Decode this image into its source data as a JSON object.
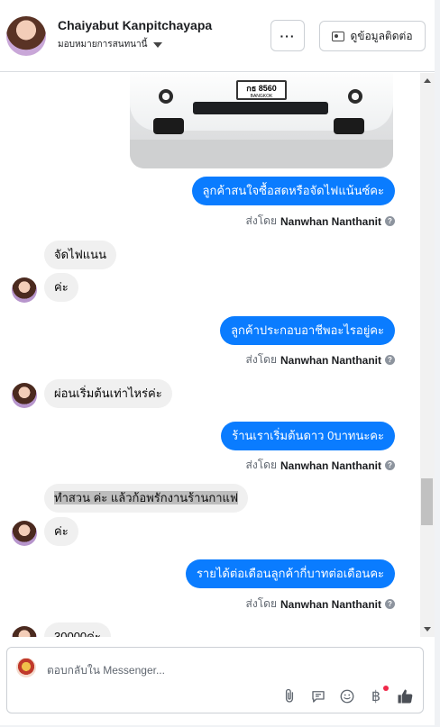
{
  "header": {
    "name": "Chaiyabut Kanpitchayapa",
    "assign_label": "มอบหมายการสนทนานี้",
    "more_label": "···",
    "info_button_label": "ดูข้อมูลติดต่อ"
  },
  "car_image": {
    "plate_text": "กธ 8560",
    "plate_sub": "BANGKOK"
  },
  "messages": [
    {
      "direction": "out",
      "text": "ลูกค้าสนใจซื้อสดหรือจัดไฟแน้นซ์คะ",
      "sent_prefix": "ส่งโดย",
      "sent_by": "Nanwhan Nanthanit"
    },
    {
      "direction": "in",
      "text": "จัดไฟแนน"
    },
    {
      "direction": "in",
      "text": "ค่ะ"
    },
    {
      "direction": "out",
      "text": "ลูกค้าประกอบอาชีพอะไรอยู่คะ",
      "sent_prefix": "ส่งโดย",
      "sent_by": "Nanwhan Nanthanit"
    },
    {
      "direction": "in",
      "text": "ผ่อนเริ่มต้นเท่าไหร่ค่ะ"
    },
    {
      "direction": "out",
      "text": "ร้านเราเริ่มต้นดาว 0บาทนะคะ",
      "sent_prefix": "ส่งโดย",
      "sent_by": "Nanwhan Nanthanit"
    },
    {
      "direction": "in",
      "text": "ทำสวน  ค่ะ  แล้วก้อพรักงานร้านกาแฟ"
    },
    {
      "direction": "in",
      "text": "ค่ะ"
    },
    {
      "direction": "out",
      "text": "รายได้ต่อเดือนลูกค้ากี่บาทต่อเดือนคะ",
      "sent_prefix": "ส่งโดย",
      "sent_by": "Nanwhan Nanthanit"
    },
    {
      "direction": "in",
      "text": "30000ค่ะ"
    }
  ],
  "composer": {
    "placeholder": "ตอบกลับใน Messenger...",
    "icons": [
      "attachment-icon",
      "saved-reply-icon",
      "emoji-icon",
      "baht-payment-icon",
      "like-icon"
    ]
  }
}
